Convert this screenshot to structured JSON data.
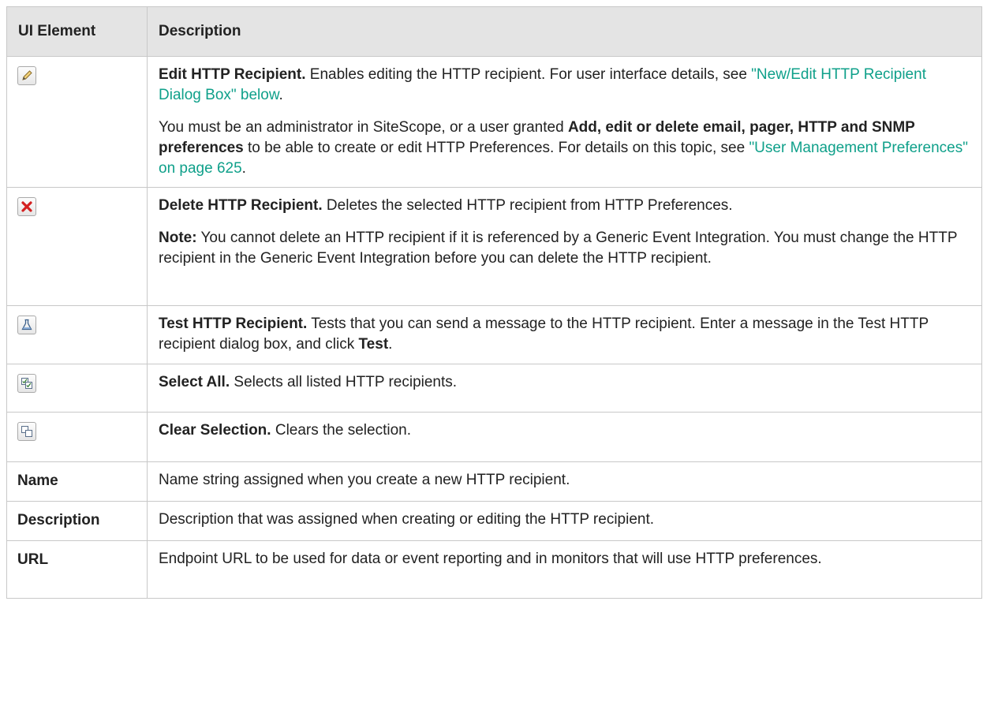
{
  "header": {
    "col1": "UI Element",
    "col2": "Description"
  },
  "icons": {
    "edit": "pencil-icon",
    "delete": "red-x-delete-icon",
    "test": "flask-test-icon",
    "select_all": "select-all-icon",
    "clear": "clear-selection-icon"
  },
  "rows": {
    "edit": {
      "title": "Edit HTTP Recipient.",
      "text1": " Enables editing the HTTP recipient. For user interface details, see ",
      "link1": "\"New/Edit HTTP Recipient Dialog Box\" below",
      "text1_end": ".",
      "p2_a": "You must be an administrator in SiteScope, or a user granted ",
      "p2_bold": "Add, edit or delete email, pager, HTTP and SNMP preferences",
      "p2_b": " to be able to create or edit HTTP Preferences. For details on this topic, see ",
      "link2": "\"User Management Preferences\" on page 625",
      "p2_end": "."
    },
    "delete": {
      "title": "Delete HTTP Recipient.",
      "text1": " Deletes the selected HTTP recipient from HTTP Preferences.",
      "note_label": "Note:",
      "note_text": " You cannot delete an HTTP recipient if it is referenced by a Generic Event Integration. You must change the HTTP recipient in the Generic Event Integration before you can delete the HTTP recipient."
    },
    "test": {
      "title": "Test HTTP Recipient.",
      "text1": " Tests that you can send a message to the HTTP recipient. Enter a message in the Test HTTP recipient dialog box, and click ",
      "bold_end": "Test",
      "text_end": "."
    },
    "select_all": {
      "title": "Select All.",
      "text1": " Selects all listed HTTP recipients."
    },
    "clear": {
      "title": "Clear Selection.",
      "text1": " Clears the selection."
    },
    "name": {
      "label": "Name",
      "desc": "Name string assigned when you create a new HTTP recipient."
    },
    "description": {
      "label": "Description",
      "desc": "Description that was assigned when creating or editing the HTTP recipient."
    },
    "url": {
      "label": "URL",
      "desc": "Endpoint URL to be used for data or event reporting and in monitors that will use HTTP preferences."
    }
  }
}
